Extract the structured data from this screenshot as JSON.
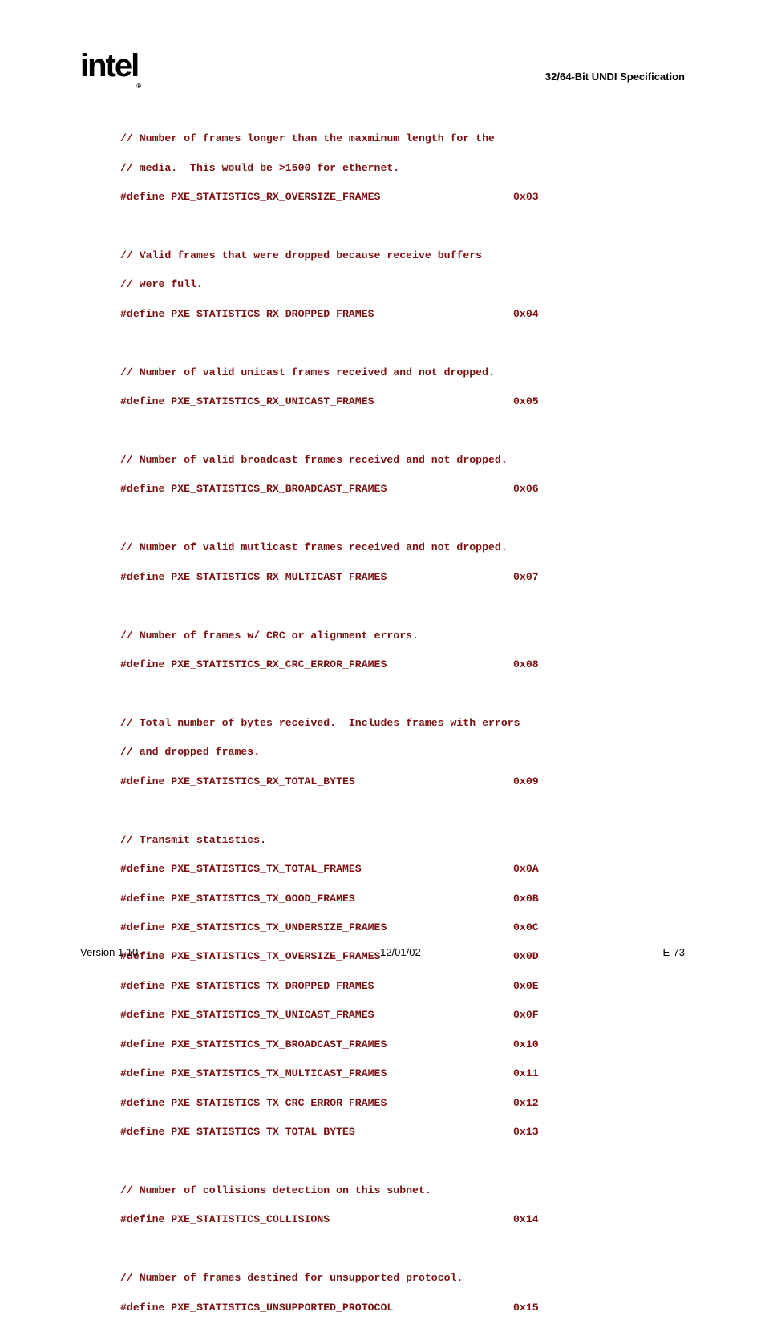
{
  "header": {
    "logo_text": "intel",
    "title": "32/64-Bit UNDI Specification"
  },
  "code": {
    "c1": "// Number of frames longer than the maxminum length for the",
    "c2": "// media.  This would be >1500 for ethernet.",
    "d1l": "#define PXE_STATISTICS_RX_OVERSIZE_FRAMES",
    "d1r": "0x03",
    "c3": "// Valid frames that were dropped because receive buffers",
    "c4": "// were full.",
    "d2l": "#define PXE_STATISTICS_RX_DROPPED_FRAMES",
    "d2r": "0x04",
    "c5": "// Number of valid unicast frames received and not dropped.",
    "d3l": "#define PXE_STATISTICS_RX_UNICAST_FRAMES",
    "d3r": "0x05",
    "c6": "// Number of valid broadcast frames received and not dropped.",
    "d4l": "#define PXE_STATISTICS_RX_BROADCAST_FRAMES",
    "d4r": "0x06",
    "c7": "// Number of valid mutlicast frames received and not dropped.",
    "d5l": "#define PXE_STATISTICS_RX_MULTICAST_FRAMES",
    "d5r": "0x07",
    "c8": "// Number of frames w/ CRC or alignment errors.",
    "d6l": "#define PXE_STATISTICS_RX_CRC_ERROR_FRAMES",
    "d6r": "0x08",
    "c9": "// Total number of bytes received.  Includes frames with errors",
    "c10": "// and dropped frames.",
    "d7l": "#define PXE_STATISTICS_RX_TOTAL_BYTES",
    "d7r": "0x09",
    "c11": "// Transmit statistics.",
    "d8l": "#define PXE_STATISTICS_TX_TOTAL_FRAMES",
    "d8r": "0x0A",
    "d9l": "#define PXE_STATISTICS_TX_GOOD_FRAMES",
    "d9r": "0x0B",
    "d10l": "#define PXE_STATISTICS_TX_UNDERSIZE_FRAMES",
    "d10r": "0x0C",
    "d11l": "#define PXE_STATISTICS_TX_OVERSIZE_FRAMES",
    "d11r": "0x0D",
    "d12l": "#define PXE_STATISTICS_TX_DROPPED_FRAMES",
    "d12r": "0x0E",
    "d13l": "#define PXE_STATISTICS_TX_UNICAST_FRAMES",
    "d13r": "0x0F",
    "d14l": "#define PXE_STATISTICS_TX_BROADCAST_FRAMES",
    "d14r": "0x10",
    "d15l": "#define PXE_STATISTICS_TX_MULTICAST_FRAMES",
    "d15r": "0x11",
    "d16l": "#define PXE_STATISTICS_TX_CRC_ERROR_FRAMES",
    "d16r": "0x12",
    "d17l": "#define PXE_STATISTICS_TX_TOTAL_BYTES",
    "d17r": "0x13",
    "c12": "// Number of collisions detection on this subnet.",
    "d18l": "#define PXE_STATISTICS_COLLISIONS",
    "d18r": "0x14",
    "c13": "// Number of frames destined for unsupported protocol.",
    "d19l": "#define PXE_STATISTICS_UNSUPPORTED_PROTOCOL",
    "d19r": "0x15"
  },
  "footer": {
    "left": "Version 1.10",
    "center": "12/01/02",
    "right": "E-73"
  }
}
